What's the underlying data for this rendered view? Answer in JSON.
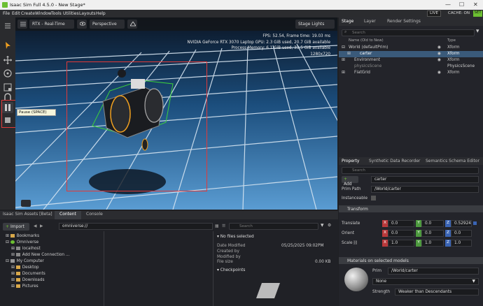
{
  "window": {
    "title": "Isaac Sim Full 4.5.0 - New Stage*",
    "minimize": "—",
    "maximize": "☐",
    "close": "✕"
  },
  "menu": {
    "items": [
      "File",
      "Edit",
      "Create",
      "Window",
      "Tools",
      "Utilities",
      "Layouts",
      "Help"
    ],
    "live": "LIVE",
    "cache": "CACHE: ON",
    "set": "SET"
  },
  "viewport": {
    "render_mode": "RTX - Real-Time",
    "camera": "Perspective",
    "stage_lights": "Stage Lights",
    "stats": [
      "FPS: 52.54, Frame time: 19.03 ms",
      "NVIDIA GeForce RTX 3070 Laptop GPU: 2.3 GiB used, 20.7 GiB available",
      "Process Memory: 6.1 GiB used, 33.5 GiB available",
      "1280x720"
    ],
    "tooltip": "Pause (SPACE)"
  },
  "stage": {
    "tabs": [
      "Stage",
      "Layer",
      "Render Settings"
    ],
    "search_placeholder": "Search",
    "col_name": "Name (Old to New)",
    "col_type": "Type",
    "items": [
      {
        "name": "World (defaultPrim)",
        "type": "Xform"
      },
      {
        "name": "carter",
        "type": "Xform"
      },
      {
        "name": "Environment",
        "type": "Xform"
      },
      {
        "name": "physicsScene",
        "type": "PhysicsScene"
      },
      {
        "name": "FlatGrid",
        "type": "Xform"
      }
    ]
  },
  "property": {
    "tabs": [
      "Property",
      "Synthetic Data Recorder",
      "Semantics Schema Editor"
    ],
    "search_placeholder": "Search",
    "add_label": "Add",
    "name_value": "carter",
    "prim_path_label": "Prim Path",
    "prim_path_value": "/World/carter",
    "instanceable_label": "Instanceable",
    "transform_header": "Transform",
    "translate_label": "Translate",
    "orient_label": "Orient",
    "scale_label": "Scale",
    "translate": [
      "0.0",
      "0.0",
      "0.52924"
    ],
    "orient": [
      "0.0",
      "0.0",
      "0.0"
    ],
    "scale": [
      "1.0",
      "1.0",
      "1.0"
    ],
    "materials_header": "Materials on selected models",
    "prim_label": "Prim",
    "material_prim": "/World/carter",
    "material_value": "None",
    "strength_label": "Strength",
    "strength_value": "Weaker than Descendants"
  },
  "bottom": {
    "tabs": [
      "Isaac Sim Assets [Beta]",
      "Content",
      "Console"
    ],
    "import_label": "Import",
    "path_value": "omniverse://",
    "search_placeholder": "Search",
    "tree": [
      "Bookmarks",
      "Omniverse",
      "localhost",
      "Add New Connection ...",
      "My Computer",
      "Desktop",
      "Documents",
      "Downloads",
      "Pictures"
    ],
    "no_files": "No files selected",
    "details": [
      {
        "label": "Date Modified",
        "value": "05/25/2025 09:02PM"
      },
      {
        "label": "Created by",
        "value": ""
      },
      {
        "label": "Modified by",
        "value": ""
      },
      {
        "label": "File size",
        "value": "0.00 KB"
      }
    ],
    "checkpoints": "Checkpoints"
  },
  "colors": {
    "accent": "#6cbf32",
    "selection": "#e13a3a",
    "grid": "#4a9fd8"
  }
}
